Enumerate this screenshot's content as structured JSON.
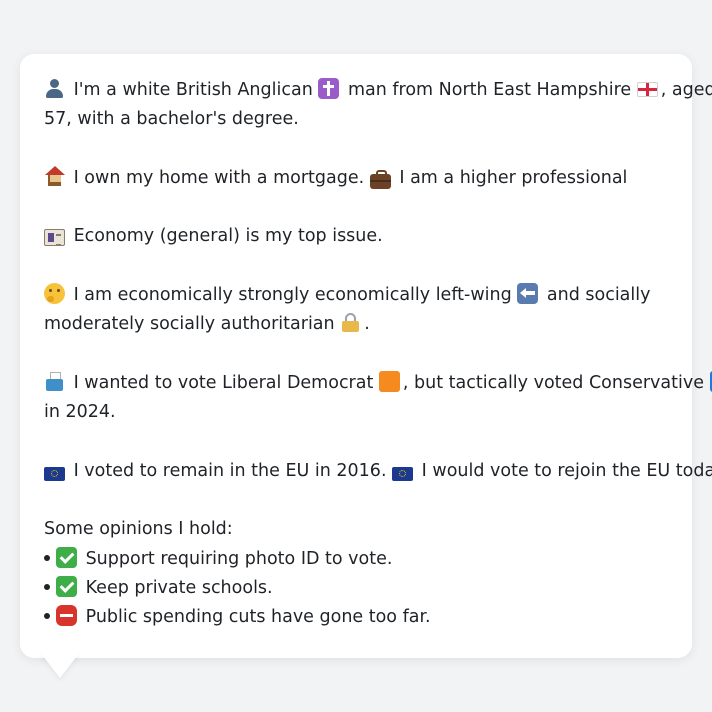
{
  "profile": {
    "line1": [
      {
        "icon": "user-icon",
        "text": "I'm a white British Anglican"
      },
      {
        "icon": "latin-cross-icon",
        "text": "man from North East Hampshire"
      },
      {
        "icon": "england-flag-icon",
        "text": ", aged"
      }
    ],
    "line1b": "57, with a bachelor's degree.",
    "home": "I own my home with a mortgage.",
    "job": "I am a higher professional",
    "issue": "Economy (general) is my top issue.",
    "ideology_a": "I am economically strongly economically left-wing",
    "ideology_b": "and socially",
    "ideology_c": "moderately socially authoritarian",
    "ideology_d": ".",
    "vote_a": "I wanted to vote Liberal Democrat",
    "vote_b": ", but tactically voted Conservative",
    "vote_c": "in 2024.",
    "eu_a": "I voted to remain in the EU in 2016.",
    "eu_b": "I would vote to rejoin the EU today.",
    "opinions_heading": "Some opinions I hold:",
    "opinions": [
      {
        "icon": "check-icon",
        "text": "Support requiring photo ID to vote."
      },
      {
        "icon": "check-icon",
        "text": "Keep private schools."
      },
      {
        "icon": "stop-sign-icon",
        "text": "Public spending cuts have gone too far."
      }
    ]
  },
  "colors": {
    "background": "#f2f3f5",
    "card": "#ffffff",
    "text": "#1f2328",
    "lib_dem_orange": "#f58a1f",
    "conservative_blue": "#1f7ae0"
  }
}
